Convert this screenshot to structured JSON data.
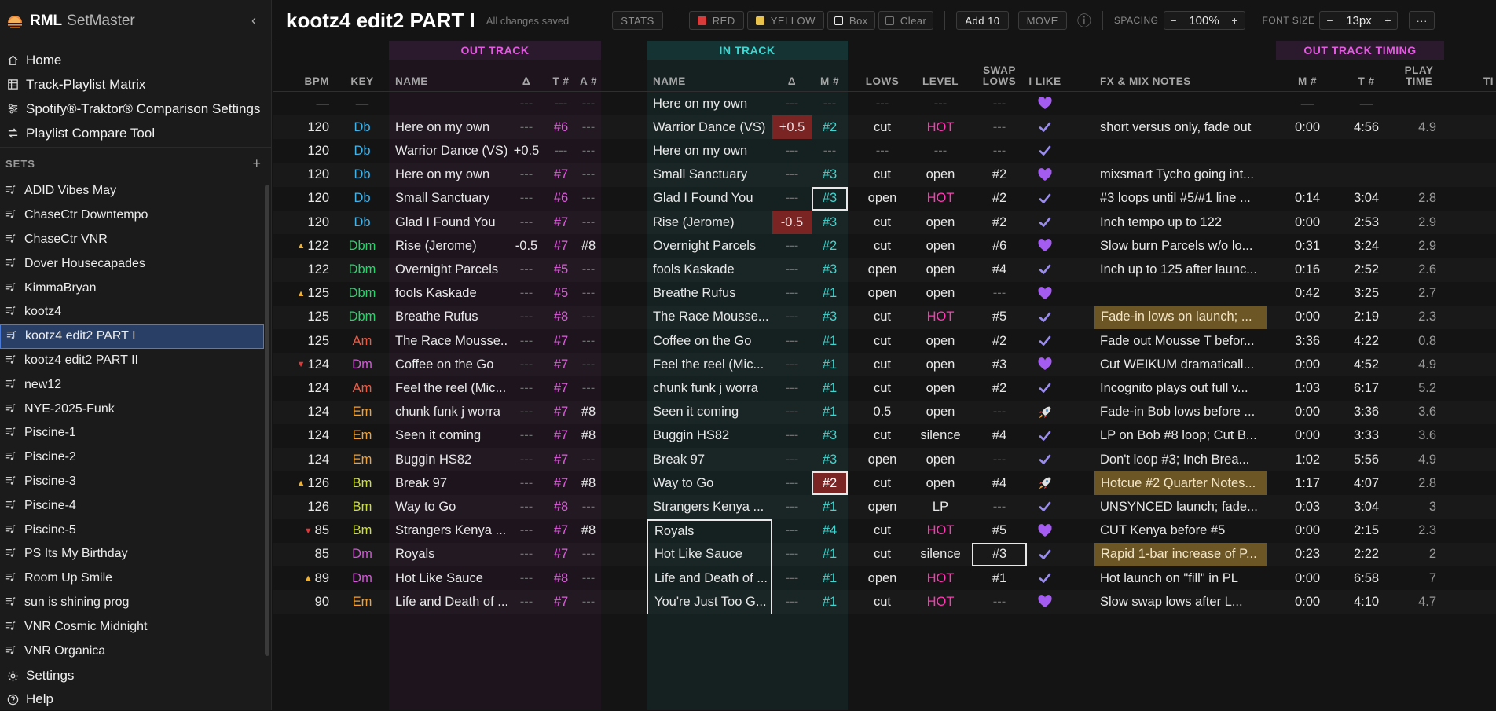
{
  "app": {
    "name": "RML",
    "name_suffix": "SetMaster"
  },
  "nav": [
    {
      "label": "Home",
      "icon": "home-icon"
    },
    {
      "label": "Track-Playlist Matrix",
      "icon": "table-icon"
    },
    {
      "label": "Spotify®-Traktor® Comparison Settings",
      "icon": "sliders-icon"
    },
    {
      "label": "Playlist Compare Tool",
      "icon": "compare-icon"
    }
  ],
  "sets_header": "SETS",
  "sets": [
    "ADID Vibes May",
    "ChaseCtr Downtempo",
    "ChaseCtr VNR",
    "Dover Housecapades",
    "KimmaBryan",
    "kootz4",
    "kootz4 edit2 PART I",
    "kootz4 edit2 PART II",
    "new12",
    "NYE-2025-Funk",
    "Piscine-1",
    "Piscine-2",
    "Piscine-3",
    "Piscine-4",
    "Piscine-5",
    "PS Its My Birthday",
    "Room Up Smile",
    "sun is shining prog",
    "VNR Cosmic Midnight",
    "VNR Organica"
  ],
  "active_set": "kootz4 edit2 PART I",
  "footer": [
    {
      "label": "Settings",
      "icon": "gear-icon"
    },
    {
      "label": "Help",
      "icon": "help-icon"
    }
  ],
  "toolbar": {
    "title": "kootz4 edit2 PART I",
    "status": "All changes saved",
    "stats": "STATS",
    "red": "RED",
    "yellow": "YELLOW",
    "box": "Box",
    "clear": "Clear",
    "add10": "Add 10",
    "move": "MOVE",
    "info": "ⓘ",
    "spacing_label": "SPACING",
    "spacing_value": "100%",
    "fontsize_label": "FONT SIZE",
    "fontsize_value": "13px",
    "more": "···",
    "minus": "−",
    "plus": "+"
  },
  "colors": {
    "red": "#d93a3a",
    "yellow": "#e8c24a",
    "pink": "#e25be0",
    "teal": "#3dd6d0",
    "hot": "#ff3ab5"
  },
  "groups": {
    "out_track": "OUT TRACK",
    "in_track": "IN TRACK",
    "out_timing": "OUT TRACK TIMING"
  },
  "headers": {
    "bpm": "BPM",
    "key": "KEY",
    "out_name": "NAME",
    "out_delta": "Δ",
    "out_t": "T #",
    "out_a": "A #",
    "in_name": "NAME",
    "in_delta": "Δ",
    "in_m": "M #",
    "lows": "LOWS",
    "level": "LEVEL",
    "swap_lows": "SWAP LOWS",
    "i_like": "I LIKE",
    "fx": "FX & MIX NOTES",
    "m2": "M #",
    "t2": "T #",
    "play_time": "PLAY TIME",
    "ti": "TI"
  },
  "rows": [
    {
      "arrow": "",
      "bpm": "—",
      "key": "—",
      "out_name": "",
      "out_delta": "---",
      "out_t": "---",
      "out_a": "---",
      "in_name": "Here on my own",
      "in_delta": "---",
      "in_m": "---",
      "lows": "---",
      "level": "---",
      "swap": "---",
      "like": "heart",
      "fx": "",
      "m2": "—",
      "t2": "—",
      "play": ""
    },
    {
      "arrow": "",
      "bpm": "120",
      "key": "Db",
      "out_name": "Here on my own",
      "out_delta": "---",
      "out_t": "#6",
      "out_a": "---",
      "in_name": "Warrior Dance (VS)",
      "in_delta": "+0.5",
      "in_m": "#2",
      "lows": "cut",
      "level": "HOT",
      "swap": "---",
      "like": "check",
      "fx": "short versus only, fade out",
      "m2": "0:00",
      "t2": "4:56",
      "play": "4.9"
    },
    {
      "arrow": "",
      "bpm": "120",
      "key": "Db",
      "out_name": "Warrior Dance (VS)",
      "out_delta": "+0.5",
      "out_t": "---",
      "out_a": "---",
      "in_name": "Here on my own",
      "in_delta": "---",
      "in_m": "---",
      "lows": "---",
      "level": "---",
      "swap": "---",
      "like": "check",
      "fx": "",
      "m2": "",
      "t2": "",
      "play": ""
    },
    {
      "arrow": "",
      "bpm": "120",
      "key": "Db",
      "out_name": "Here on my own",
      "out_delta": "---",
      "out_t": "#7",
      "out_a": "---",
      "in_name": "Small Sanctuary",
      "in_delta": "---",
      "in_m": "#3",
      "lows": "cut",
      "level": "open",
      "swap": "#2",
      "like": "heart",
      "fx": "mixsmart Tycho going int...",
      "m2": "",
      "t2": "",
      "play": ""
    },
    {
      "arrow": "",
      "bpm": "120",
      "key": "Db",
      "out_name": "Small Sanctuary",
      "out_delta": "---",
      "out_t": "#6",
      "out_a": "---",
      "in_name": "Glad I Found You",
      "in_delta": "---",
      "in_m": "#3",
      "lows": "open",
      "level": "HOT",
      "swap": "#2",
      "like": "check",
      "fx": "#3 loops until #5/#1 line ...",
      "m2": "0:14",
      "t2": "3:04",
      "play": "2.8"
    },
    {
      "arrow": "",
      "bpm": "120",
      "key": "Db",
      "out_name": "Glad I Found You",
      "out_delta": "---",
      "out_t": "#7",
      "out_a": "---",
      "in_name": "Rise (Jerome)",
      "in_delta": "-0.5",
      "in_m": "#3",
      "lows": "cut",
      "level": "open",
      "swap": "#2",
      "like": "check",
      "fx": "Inch tempo up to 122",
      "m2": "0:00",
      "t2": "2:53",
      "play": "2.9"
    },
    {
      "arrow": "up",
      "bpm": "122",
      "key": "Dbm",
      "out_name": "Rise (Jerome)",
      "out_delta": "-0.5",
      "out_t": "#7",
      "out_a": "#8",
      "in_name": "Overnight Parcels",
      "in_delta": "---",
      "in_m": "#2",
      "lows": "cut",
      "level": "open",
      "swap": "#6",
      "like": "heart",
      "fx": "Slow burn Parcels w/o lo...",
      "m2": "0:31",
      "t2": "3:24",
      "play": "2.9"
    },
    {
      "arrow": "",
      "bpm": "122",
      "key": "Dbm",
      "out_name": "Overnight Parcels",
      "out_delta": "---",
      "out_t": "#5",
      "out_a": "---",
      "in_name": "fools Kaskade",
      "in_delta": "---",
      "in_m": "#3",
      "lows": "open",
      "level": "open",
      "swap": "#4",
      "like": "check",
      "fx": "Inch up to 125 after launc...",
      "m2": "0:16",
      "t2": "2:52",
      "play": "2.6"
    },
    {
      "arrow": "up",
      "bpm": "125",
      "key": "Dbm",
      "out_name": "fools Kaskade",
      "out_delta": "---",
      "out_t": "#5",
      "out_a": "---",
      "in_name": "Breathe Rufus",
      "in_delta": "---",
      "in_m": "#1",
      "lows": "open",
      "level": "open",
      "swap": "---",
      "like": "heart",
      "fx": "",
      "m2": "0:42",
      "t2": "3:25",
      "play": "2.7"
    },
    {
      "arrow": "",
      "bpm": "125",
      "key": "Dbm",
      "out_name": "Breathe Rufus",
      "out_delta": "---",
      "out_t": "#8",
      "out_a": "---",
      "in_name": "The Race Mousse...",
      "in_delta": "---",
      "in_m": "#3",
      "lows": "cut",
      "level": "HOT",
      "swap": "#5",
      "like": "check",
      "fx": "Fade-in lows on launch; ...",
      "m2": "0:00",
      "t2": "2:19",
      "play": "2.3"
    },
    {
      "arrow": "",
      "bpm": "125",
      "key": "Am",
      "out_name": "The Race Mousse...",
      "out_delta": "---",
      "out_t": "#7",
      "out_a": "---",
      "in_name": "Coffee on the Go",
      "in_delta": "---",
      "in_m": "#1",
      "lows": "cut",
      "level": "open",
      "swap": "#2",
      "like": "check",
      "fx": "Fade out Mousse T befor...",
      "m2": "3:36",
      "t2": "4:22",
      "play": "0.8"
    },
    {
      "arrow": "down",
      "bpm": "124",
      "key": "Dm",
      "out_name": "Coffee on the Go",
      "out_delta": "---",
      "out_t": "#7",
      "out_a": "---",
      "in_name": "Feel the reel (Mic...",
      "in_delta": "---",
      "in_m": "#1",
      "lows": "cut",
      "level": "open",
      "swap": "#3",
      "like": "heart",
      "fx": "Cut WEIKUM dramaticall...",
      "m2": "0:00",
      "t2": "4:52",
      "play": "4.9"
    },
    {
      "arrow": "",
      "bpm": "124",
      "key": "Am",
      "out_name": "Feel the reel (Mic...",
      "out_delta": "---",
      "out_t": "#7",
      "out_a": "---",
      "in_name": "chunk funk j worra",
      "in_delta": "---",
      "in_m": "#1",
      "lows": "cut",
      "level": "open",
      "swap": "#2",
      "like": "check",
      "fx": "Incognito plays out full v...",
      "m2": "1:03",
      "t2": "6:17",
      "play": "5.2"
    },
    {
      "arrow": "",
      "bpm": "124",
      "key": "Em",
      "out_name": "chunk funk j worra",
      "out_delta": "---",
      "out_t": "#7",
      "out_a": "#8",
      "in_name": "Seen it coming",
      "in_delta": "---",
      "in_m": "#1",
      "lows": "0.5",
      "level": "open",
      "swap": "---",
      "like": "rocket",
      "fx": "Fade-in Bob lows before ...",
      "m2": "0:00",
      "t2": "3:36",
      "play": "3.6"
    },
    {
      "arrow": "",
      "bpm": "124",
      "key": "Em",
      "out_name": "Seen it coming",
      "out_delta": "---",
      "out_t": "#7",
      "out_a": "#8",
      "in_name": "Buggin HS82",
      "in_delta": "---",
      "in_m": "#3",
      "lows": "cut",
      "level": "silence",
      "swap": "#4",
      "like": "check",
      "fx": "LP on Bob #8 loop; Cut B...",
      "m2": "0:00",
      "t2": "3:33",
      "play": "3.6"
    },
    {
      "arrow": "",
      "bpm": "124",
      "key": "Em",
      "out_name": "Buggin HS82",
      "out_delta": "---",
      "out_t": "#7",
      "out_a": "---",
      "in_name": "Break 97",
      "in_delta": "---",
      "in_m": "#3",
      "lows": "open",
      "level": "open",
      "swap": "---",
      "like": "check",
      "fx": "Don't loop #3; Inch Brea...",
      "m2": "1:02",
      "t2": "5:56",
      "play": "4.9"
    },
    {
      "arrow": "up",
      "bpm": "126",
      "key": "Bm",
      "out_name": "Break 97",
      "out_delta": "---",
      "out_t": "#7",
      "out_a": "#8",
      "in_name": "Way to Go",
      "in_delta": "---",
      "in_m": "#2",
      "lows": "cut",
      "level": "open",
      "swap": "#4",
      "like": "rocket",
      "fx": "Hotcue #2 Quarter Notes...",
      "m2": "1:17",
      "t2": "4:07",
      "play": "2.8"
    },
    {
      "arrow": "",
      "bpm": "126",
      "key": "Bm",
      "out_name": "Way to Go",
      "out_delta": "---",
      "out_t": "#8",
      "out_a": "---",
      "in_name": "Strangers Kenya ...",
      "in_delta": "---",
      "in_m": "#1",
      "lows": "open",
      "level": "LP",
      "swap": "---",
      "like": "check",
      "fx": "UNSYNCED launch; fade...",
      "m2": "0:03",
      "t2": "3:04",
      "play": "3"
    },
    {
      "arrow": "down",
      "bpm": "85",
      "key": "Bm",
      "out_name": "Strangers Kenya ...",
      "out_delta": "---",
      "out_t": "#7",
      "out_a": "#8",
      "in_name": "Royals",
      "in_delta": "---",
      "in_m": "#4",
      "lows": "cut",
      "level": "HOT",
      "swap": "#5",
      "like": "heart",
      "fx": "CUT Kenya before #5",
      "m2": "0:00",
      "t2": "2:15",
      "play": "2.3"
    },
    {
      "arrow": "",
      "bpm": "85",
      "key": "Dm",
      "out_name": "Royals",
      "out_delta": "---",
      "out_t": "#7",
      "out_a": "---",
      "in_name": "Hot Like Sauce",
      "in_delta": "---",
      "in_m": "#1",
      "lows": "cut",
      "level": "silence",
      "swap": "#3",
      "like": "check",
      "fx": "Rapid 1-bar increase of P...",
      "m2": "0:23",
      "t2": "2:22",
      "play": "2"
    },
    {
      "arrow": "up",
      "bpm": "89",
      "key": "Dm",
      "out_name": "Hot Like Sauce",
      "out_delta": "---",
      "out_t": "#8",
      "out_a": "---",
      "in_name": "Life and Death of ...",
      "in_delta": "---",
      "in_m": "#1",
      "lows": "open",
      "level": "HOT",
      "swap": "#1",
      "like": "check",
      "fx": "Hot launch on \"fill\" in PL",
      "m2": "0:00",
      "t2": "6:58",
      "play": "7"
    },
    {
      "arrow": "",
      "bpm": "90",
      "key": "Em",
      "out_name": "Life and Death of ...",
      "out_delta": "---",
      "out_t": "#7",
      "out_a": "---",
      "in_name": "You're Just Too G...",
      "in_delta": "---",
      "in_m": "#1",
      "lows": "cut",
      "level": "HOT",
      "swap": "---",
      "like": "heart",
      "fx": "Slow swap lows after L...",
      "m2": "0:00",
      "t2": "4:10",
      "play": "4.7"
    }
  ]
}
